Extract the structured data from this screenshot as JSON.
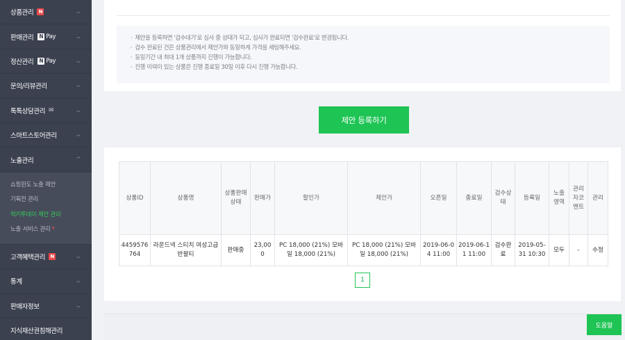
{
  "sidebar": {
    "menu": [
      {
        "label": "상품관리",
        "badge": "N"
      },
      {
        "label": "판매관리",
        "pay": "Pay"
      },
      {
        "label": "정산관리",
        "pay": "Pay"
      },
      {
        "label": "문의/리뷰관리"
      },
      {
        "label": "톡톡상담관리"
      },
      {
        "label": "스마트스토어관리"
      },
      {
        "label": "노출관리"
      }
    ],
    "submenu": [
      {
        "label": "쇼핑윈도 노출 제안"
      },
      {
        "label": "기획전 관리"
      },
      {
        "label": "럭키투데이 제안 관리"
      },
      {
        "label": "노출 서비스 관리",
        "star": "*"
      }
    ],
    "menu_after": [
      {
        "label": "고객혜택관리",
        "badge": "N"
      },
      {
        "label": "통계"
      },
      {
        "label": "판매자정보"
      },
      {
        "label": "지식재산권침해관리"
      }
    ],
    "npay_mark": "N",
    "chevron": "⌄",
    "chevron_up": "⌃",
    "chat_icon": "✉"
  },
  "notice": {
    "lines": [
      "제안을 등록하면 '검수대기'로 심사 중 상태가 되고, 심사가 완료되면 '검수완료'로 변경됩니다.",
      "검수 완료된 건은 상품관리에서 제안가와 동일하게 가격을 세팅해주세요.",
      "동일기간 내 최대 1개 상품까지 진행이 가능합니다.",
      "진행 이력이 있는 상품은 진행 종료일 30일 이후 다시 진행 가능합니다."
    ],
    "bullet": "·"
  },
  "register_button": "제안 등록하기",
  "table": {
    "headers": [
      "상품ID",
      "상품명",
      "상품판매상태",
      "판매가",
      "할인가",
      "제안가",
      "오픈일",
      "종료일",
      "검수상태",
      "등록일",
      "노출영역",
      "관리자코멘트",
      "관리"
    ],
    "rows": [
      [
        "4459576764",
        "라운드넥 스티치 여성고급반팔티",
        "판매중",
        "23,000",
        "PC 18,000 (21%) 모바일 18,000 (21%)",
        "PC 18,000 (21%) 모바일 18,000 (21%)",
        "2019-06-04 11:00",
        "2019-06-11 11:00",
        "검수완료",
        "2019-05-31 10:30",
        "모두",
        "-",
        "수정"
      ]
    ]
  },
  "pagination": {
    "current": "1"
  },
  "help_button": "도움말",
  "colors": {
    "sidebar_bg": "#3c4150",
    "accent_green": "#1ec454",
    "active_sub": "#36c95c",
    "price_navy": "#2b3b86"
  }
}
